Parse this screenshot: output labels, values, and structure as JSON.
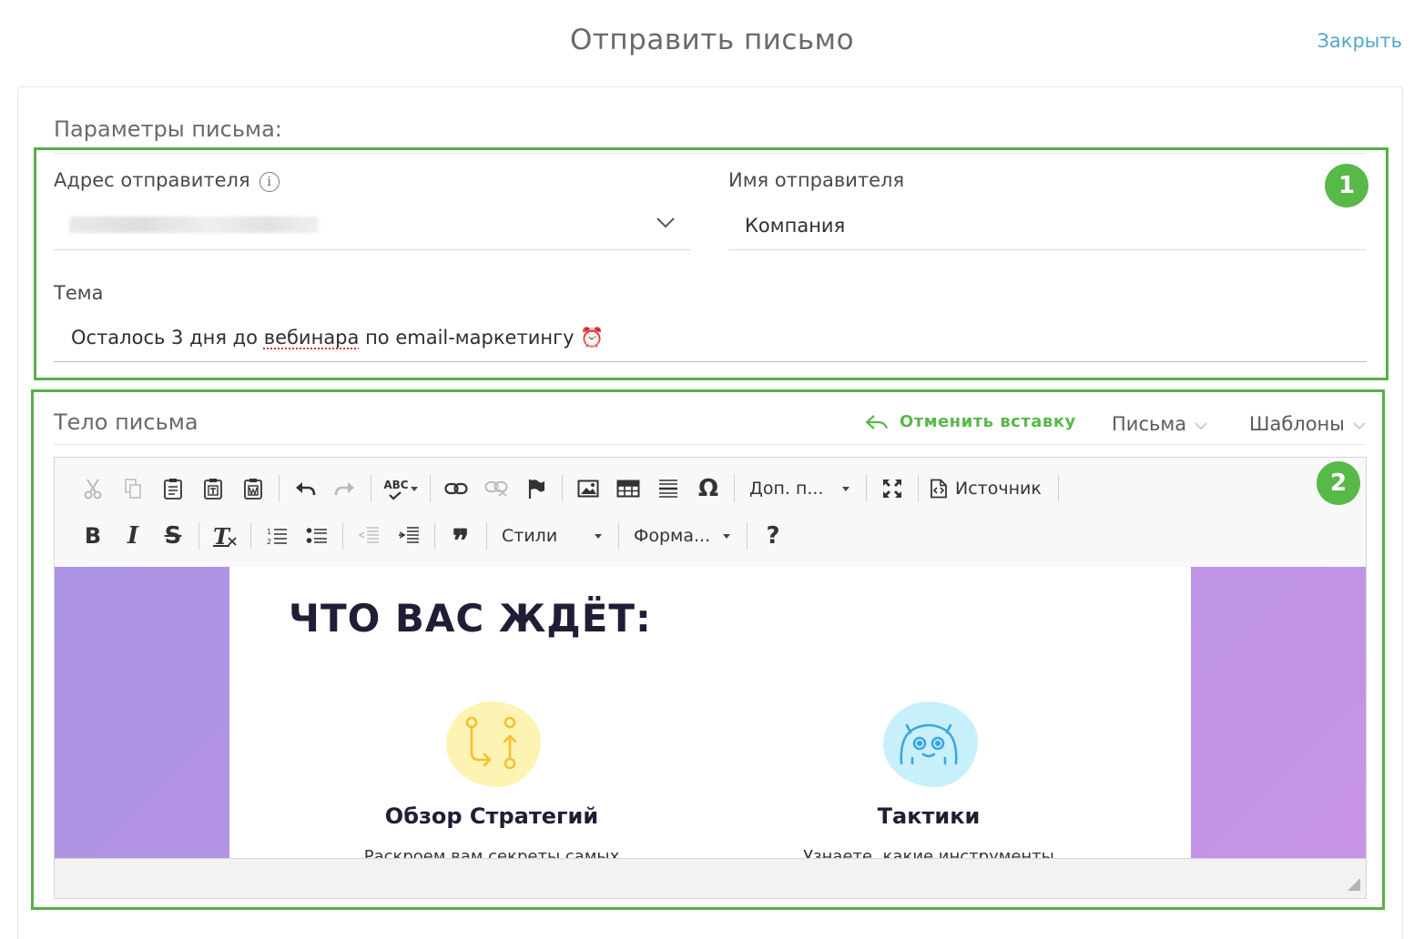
{
  "header": {
    "title": "Отправить письмо",
    "close_label": "Закрыть"
  },
  "params": {
    "section_title": "Параметры письма:",
    "badge": "1",
    "sender_address": {
      "label": "Адрес отправителя",
      "value_blurred": true,
      "info_icon": "info-icon",
      "dropdown_icon": "chevron-down-icon"
    },
    "sender_name": {
      "label": "Имя отправителя",
      "value": "Компания"
    },
    "subject": {
      "label": "Тема",
      "value_before": "Осталось 3 дня до ",
      "value_spell": "вебинара",
      "value_after": " по email-маркетингу ⏰"
    }
  },
  "body": {
    "section_title": "Тело письма",
    "badge": "2",
    "undo_paste_label": "Отменить вставку",
    "letters_label": "Письма",
    "templates_label": "Шаблоны",
    "toolbar": {
      "row1": [
        "cut-icon",
        "copy-icon",
        "paste-icon",
        "paste-text-icon",
        "paste-word-icon",
        "undo-icon",
        "redo-icon",
        "spellcheck-icon",
        "link-icon",
        "unlink-icon",
        "anchor-flag-icon",
        "image-icon",
        "table-icon",
        "horizontal-rule-icon",
        "special-char-icon"
      ],
      "spellcheck_label": "ABC",
      "special_char": "Ω",
      "more_combo": "Доп. п...",
      "fullscreen_icon": "maximize-icon",
      "source_label": "Источник",
      "row2": [
        "bold-icon",
        "italic-icon",
        "strike-icon",
        "remove-format-icon",
        "numbered-list-icon",
        "bullet-list-icon",
        "outdent-icon",
        "indent-icon",
        "blockquote-icon"
      ],
      "bold": "B",
      "italic": "I",
      "strike": "S",
      "remove_format": "T",
      "quote": "❞",
      "styles_combo": "Стили",
      "format_combo": "Форма...",
      "help": "?"
    },
    "content": {
      "heading": "ЧТО ВАС ЖДЁТ:",
      "features": [
        {
          "title": "Обзор Стратегий",
          "desc": "Раскроем вам секреты самых",
          "icon": "branch-arrows-icon",
          "blob_color": "#fdf3b3"
        },
        {
          "title": "Тактики",
          "desc": "Узнаете, какие инструменты",
          "icon": "robot-face-icon",
          "blob_color": "#c8f0fb"
        }
      ]
    }
  },
  "colors": {
    "accent_green": "#58b949",
    "close_link": "#55a7c6",
    "purple_bg": "#ac93e3"
  }
}
